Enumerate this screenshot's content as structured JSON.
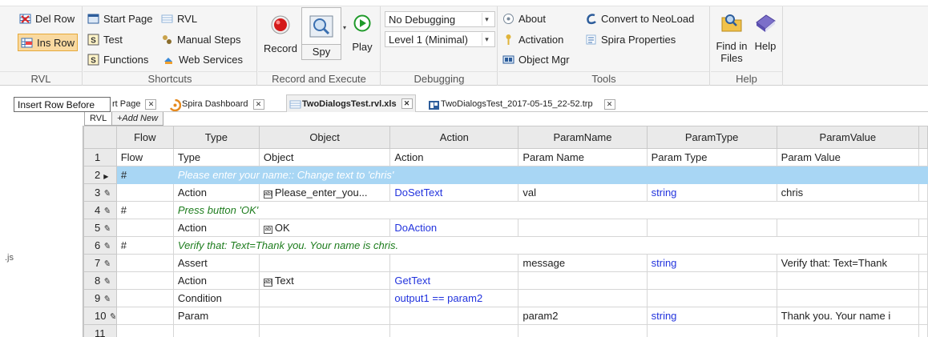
{
  "ribbon": {
    "rvl": {
      "del_row": "Del Row",
      "ins_row": "Ins Row",
      "label": "RVL"
    },
    "shortcuts": {
      "start_page": "Start Page",
      "rvl": "RVL",
      "test": "Test",
      "manual_steps": "Manual Steps",
      "functions": "Functions",
      "web_services": "Web Services",
      "label": "Shortcuts"
    },
    "record_execute": {
      "record": "Record",
      "spy": "Spy",
      "play": "Play",
      "label": "Record and Execute"
    },
    "debugging": {
      "mode": "No Debugging",
      "level": "Level 1 (Minimal)",
      "label": "Debugging"
    },
    "tools": {
      "about": "About",
      "convert": "Convert to NeoLoad",
      "activation": "Activation",
      "spira_properties": "Spira Properties",
      "object_mgr": "Object Mgr",
      "label": "Tools"
    },
    "help": {
      "find_in_files_1": "Find in",
      "find_in_files_2": "Files",
      "help": "Help",
      "label": "Help"
    }
  },
  "tooltip": "Insert Row Before",
  "left_pane": {
    "file_label": ".js"
  },
  "tabs": [
    {
      "label": "rt Page"
    },
    {
      "label": "Spira Dashboard"
    },
    {
      "label": "TwoDialogsTest.rvl.xls"
    },
    {
      "label": "TwoDialogsTest_2017-05-15_22-52.trp"
    }
  ],
  "sheet_tabs": {
    "rvl": "RVL",
    "add_new": "+Add New"
  },
  "grid": {
    "columns": [
      "Flow",
      "Type",
      "Object",
      "Action",
      "ParamName",
      "ParamType",
      "ParamValue"
    ],
    "rows": [
      {
        "num": "1",
        "flow": "Flow",
        "type": "Type",
        "object": "Object",
        "action": "Action",
        "param_name": "Param Name",
        "param_type": "Param Type",
        "param_value": "Param Value"
      },
      {
        "num": "2",
        "flow": "#",
        "comment": "Please enter your name:: Change text to 'chris'"
      },
      {
        "num": "3",
        "flow": "",
        "type": "Action",
        "object": "Please_enter_you...",
        "action": "DoSetText",
        "param_name": "val",
        "param_type": "string",
        "param_value": "chris"
      },
      {
        "num": "4",
        "flow": "#",
        "comment": "Press button 'OK'"
      },
      {
        "num": "5",
        "flow": "",
        "type": "Action",
        "object": "OK",
        "action": "DoAction",
        "param_name": "",
        "param_type": "",
        "param_value": ""
      },
      {
        "num": "6",
        "flow": "#",
        "comment": "Verify that: Text=Thank you.  Your name is chris."
      },
      {
        "num": "7",
        "flow": "",
        "type": "Assert",
        "object": "",
        "action": "",
        "param_name": "message",
        "param_type": "string",
        "param_value": "Verify that: Text=Thank"
      },
      {
        "num": "8",
        "flow": "",
        "type": "Action",
        "object": "Text",
        "action": "GetText",
        "param_name": "",
        "param_type": "",
        "param_value": ""
      },
      {
        "num": "9",
        "flow": "",
        "type": "Condition",
        "object": "",
        "action": "output1 == param2",
        "param_name": "",
        "param_type": "",
        "param_value": ""
      },
      {
        "num": "10",
        "flow": "",
        "type": "Param",
        "object": "",
        "action": "",
        "param_name": "param2",
        "param_type": "string",
        "param_value": "Thank you.  Your name i"
      },
      {
        "num": "11",
        "flow": "",
        "type": "",
        "object": "",
        "action": "",
        "param_name": "",
        "param_type": "",
        "param_value": ""
      }
    ]
  },
  "colors": {
    "selected_row": "#a8d6f4",
    "comment": "#1e7d1e",
    "action_blue": "#2233dd"
  }
}
